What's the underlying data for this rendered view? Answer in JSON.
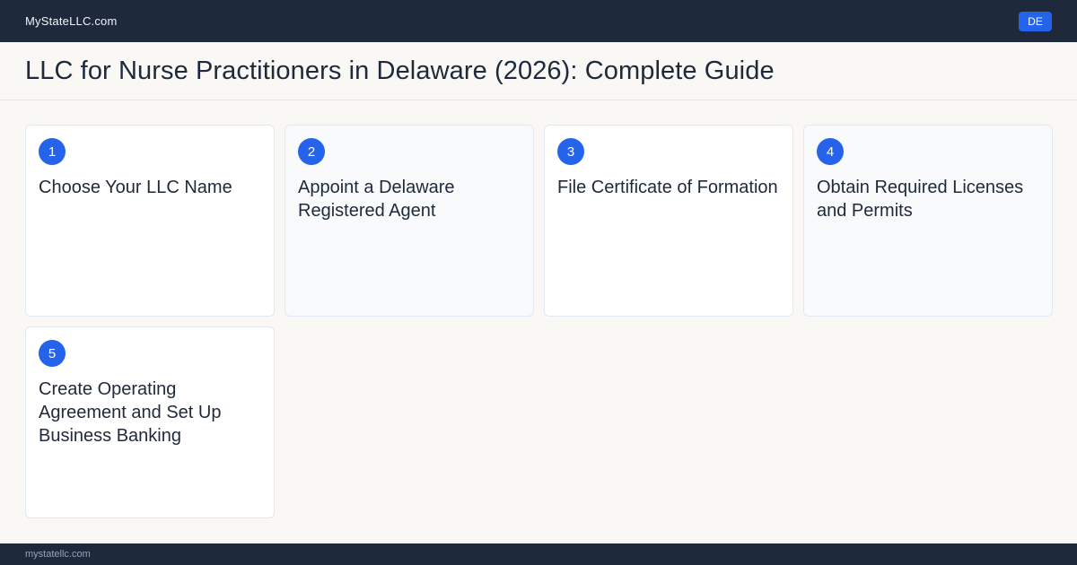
{
  "header": {
    "brand": "MyStateLLC.com",
    "state_badge": "DE"
  },
  "page": {
    "title": "LLC for Nurse Practitioners  in Delaware (2026): Complete Guide"
  },
  "steps": [
    {
      "number": "1",
      "title": "Choose Your LLC Name"
    },
    {
      "number": "2",
      "title": "Appoint a Delaware Registered  Agent"
    },
    {
      "number": "3",
      "title": "File Certificate  of Formation"
    },
    {
      "number": "4",
      "title": "Obtain Required Licenses  and Permits"
    },
    {
      "number": "5",
      "title": "Create Operating Agreement  and Set Up Business Banking"
    }
  ],
  "footer": {
    "url": "mystatellc.com"
  },
  "colors": {
    "header_bg": "#1e293b",
    "accent": "#2563eb",
    "page_bg": "#f9f8f4"
  }
}
